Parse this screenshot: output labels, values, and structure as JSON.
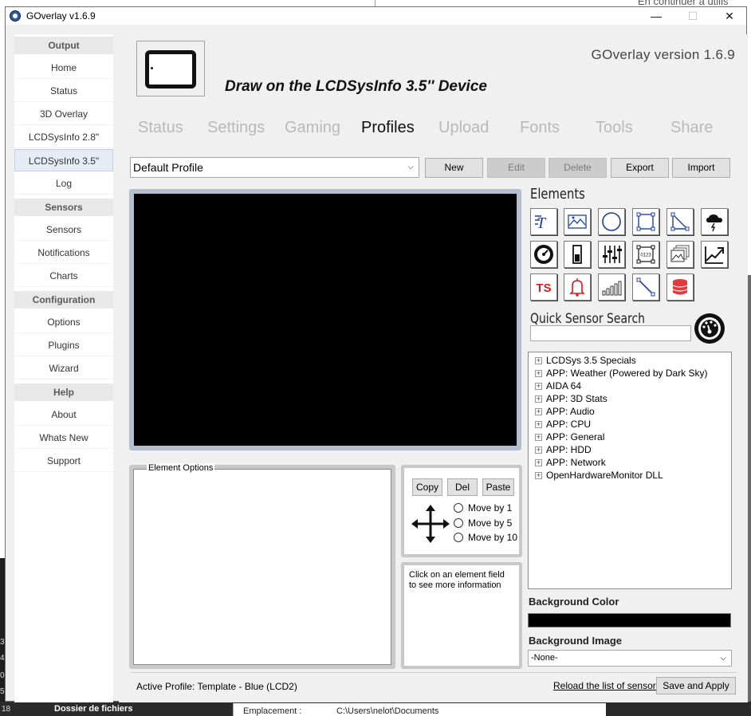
{
  "background": {
    "top_text": "En continuer a utilis",
    "left_numbers": [
      "3",
      "4",
      "0",
      "5",
      "18"
    ],
    "bottom_left": "Dossier de fichiers",
    "bottom_label": "Emplacement :",
    "bottom_path": "C:\\Users\\nelot\\Documents"
  },
  "window": {
    "title": "GOverlay v1.6.9",
    "controls": {
      "minimize": "—",
      "maximize": "☐",
      "close": "✕"
    }
  },
  "sidebar": {
    "sections": [
      {
        "title": "Output",
        "items": [
          "Home",
          "Status",
          "3D Overlay",
          "LCDSysInfo 2.8\"",
          "LCDSysInfo 3.5\"",
          "Log"
        ]
      },
      {
        "title": "Sensors",
        "items": [
          "Sensors",
          "Notifications",
          "Charts"
        ]
      },
      {
        "title": "Configuration",
        "items": [
          "Options",
          "Plugins",
          "Wizard"
        ]
      },
      {
        "title": "Help",
        "items": [
          "About",
          "Whats New",
          "Support"
        ]
      }
    ],
    "active_item": "LCDSysInfo 3.5\""
  },
  "header": {
    "version_text": "GOverlay version 1.6.9",
    "headline": "Draw on the LCDSysInfo 3.5'' Device",
    "device_icon": "tablet-icon"
  },
  "tabs": [
    "Status",
    "Settings",
    "Gaming",
    "Profiles",
    "Upload",
    "Fonts",
    "Tools",
    "Share"
  ],
  "active_tab": "Profiles",
  "profile": {
    "selected": "Default Profile",
    "buttons": {
      "new": "New",
      "edit": "Edit",
      "delete": "Delete",
      "export": "Export",
      "import": "Import"
    }
  },
  "elements": {
    "title": "Elements",
    "icons": [
      "text-icon",
      "image-icon",
      "circle-icon",
      "rectangle-icon",
      "triangle-icon",
      "weather-icon",
      "gauge-icon",
      "bar-icon",
      "sliders-icon",
      "digits-icon",
      "picture-stack-icon",
      "line-chart-icon",
      "timestamp-icon",
      "bell-icon",
      "level-bars-icon",
      "line-icon",
      "database-icon"
    ],
    "timestamp_label": "TS",
    "digits_label": "0123"
  },
  "quick_search": {
    "title": "Quick Sensor Search",
    "value": "",
    "icon": "speedometer-icon"
  },
  "sensor_tree": [
    "LCDSys 3.5 Specials",
    "APP: Weather (Powered by Dark Sky)",
    "AIDA 64",
    "APP: 3D Stats",
    "APP: Audio",
    "APP: CPU",
    "APP: General",
    "APP: HDD",
    "APP: Network",
    "OpenHardwareMonitor DLL"
  ],
  "background_settings": {
    "color_label": "Background Color",
    "color_value": "#000000",
    "image_label": "Background Image",
    "image_value": "-None-"
  },
  "element_options": {
    "legend": "Element Options"
  },
  "move_panel": {
    "copy": "Copy",
    "del": "Del",
    "paste": "Paste",
    "options": [
      "Move by 1",
      "Move by 5",
      "Move by 10"
    ],
    "move_icon": "move-arrows-icon"
  },
  "info_text": "Click on an element field to see more information",
  "status": {
    "active_profile": "Active Profile: Template - Blue (LCD2)",
    "reload_link": "Reload the list of sensors",
    "save_button": "Save and Apply"
  }
}
